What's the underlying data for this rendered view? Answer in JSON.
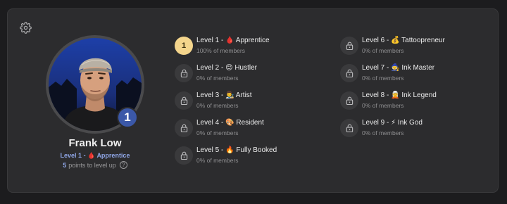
{
  "profile": {
    "name": "Frank Low",
    "level_badge": "1",
    "level_label": "Level 1 - 🩸 Apprentice",
    "points_value": "5",
    "points_text": "points to level up",
    "help_icon": "question-mark-icon"
  },
  "settings_icon": "gear-icon",
  "levels": [
    {
      "title": "Level 1 - 🩸 Apprentice",
      "members": "100% of members",
      "badge": "1",
      "unlocked": true
    },
    {
      "title": "Level 2 - 😌 Hustler",
      "members": "0% of members",
      "unlocked": false
    },
    {
      "title": "Level 3 - 👨‍🎨 Artist",
      "members": "0% of members",
      "unlocked": false
    },
    {
      "title": "Level 4 - 🎨 Resident",
      "members": "0% of members",
      "unlocked": false
    },
    {
      "title": "Level 5 - 🔥 Fully Booked",
      "members": "0% of members",
      "unlocked": false
    },
    {
      "title": "Level 6 - 💰 Tattoopreneur",
      "members": "0% of members",
      "unlocked": false
    },
    {
      "title": "Level 7 - 🧙 Ink Master",
      "members": "0% of members",
      "unlocked": false
    },
    {
      "title": "Level 8 - 🧝 Ink Legend",
      "members": "0% of members",
      "unlocked": false
    },
    {
      "title": "Level 9 - ⚡ Ink God",
      "members": "0% of members",
      "unlocked": false
    }
  ],
  "colors": {
    "background": "#1c1c1e",
    "card": "#2c2c2e",
    "accent_blue": "#3b58a8",
    "level_link": "#8fa6e6",
    "active_level": "#f4d58c"
  }
}
